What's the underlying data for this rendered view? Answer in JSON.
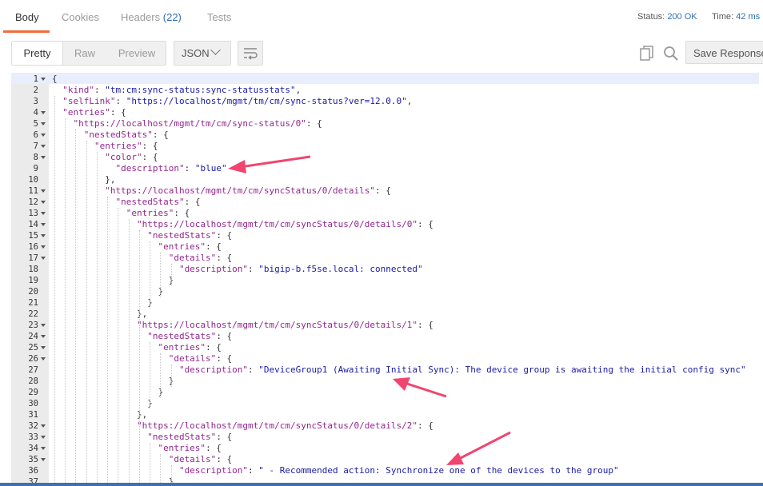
{
  "tabs": [
    {
      "label": "Body",
      "count": ""
    },
    {
      "label": "Cookies",
      "count": ""
    },
    {
      "label": "Headers",
      "count": "(22)"
    },
    {
      "label": "Tests",
      "count": ""
    }
  ],
  "status": {
    "status_label": "Status:",
    "status_value": "200 OK",
    "time_label": "Time:",
    "time_value": "42 ms"
  },
  "toolbar": {
    "view_modes": [
      "Pretty",
      "Raw",
      "Preview"
    ],
    "format": "JSON",
    "save_label": "Save Response"
  },
  "icons": {
    "wrap": "wrap-lines-icon",
    "copy": "copy-icon",
    "search": "search-icon",
    "chevron": "chevron-down-icon",
    "fold": "fold-arrow-icon"
  },
  "colors": {
    "accent": "#f26b3a",
    "link": "#2f6db5",
    "key": "#92278f",
    "string": "#1a1aa6",
    "arrow": "#f0456f"
  },
  "code_lines": [
    {
      "n": "1",
      "fold": true,
      "t": [
        {
          "c": "p",
          "v": "{"
        }
      ]
    },
    {
      "n": "2",
      "fold": false,
      "t": [
        {
          "c": "k",
          "v": "  \"kind\""
        },
        {
          "c": "p",
          "v": ": "
        },
        {
          "c": "s",
          "v": "\"tm:cm:sync-status:sync-statusstats\""
        },
        {
          "c": "p",
          "v": ","
        }
      ]
    },
    {
      "n": "3",
      "fold": false,
      "t": [
        {
          "c": "k",
          "v": "  \"selfLink\""
        },
        {
          "c": "p",
          "v": ": "
        },
        {
          "c": "s",
          "v": "\"https://localhost/mgmt/tm/cm/sync-status?ver=12.0.0\""
        },
        {
          "c": "p",
          "v": ","
        }
      ]
    },
    {
      "n": "4",
      "fold": true,
      "t": [
        {
          "c": "k",
          "v": "  \"entries\""
        },
        {
          "c": "p",
          "v": ": {"
        }
      ]
    },
    {
      "n": "5",
      "fold": true,
      "t": [
        {
          "c": "k",
          "v": "    \"https://localhost/mgmt/tm/cm/sync-status/0\""
        },
        {
          "c": "p",
          "v": ": {"
        }
      ]
    },
    {
      "n": "6",
      "fold": true,
      "t": [
        {
          "c": "k",
          "v": "      \"nestedStats\""
        },
        {
          "c": "p",
          "v": ": {"
        }
      ]
    },
    {
      "n": "7",
      "fold": true,
      "t": [
        {
          "c": "k",
          "v": "        \"entries\""
        },
        {
          "c": "p",
          "v": ": {"
        }
      ]
    },
    {
      "n": "8",
      "fold": true,
      "t": [
        {
          "c": "k",
          "v": "          \"color\""
        },
        {
          "c": "p",
          "v": ": {"
        }
      ]
    },
    {
      "n": "9",
      "fold": false,
      "t": [
        {
          "c": "k",
          "v": "            \"description\""
        },
        {
          "c": "p",
          "v": ": "
        },
        {
          "c": "s",
          "v": "\"blue\""
        }
      ]
    },
    {
      "n": "10",
      "fold": false,
      "t": [
        {
          "c": "p",
          "v": "          },"
        }
      ]
    },
    {
      "n": "11",
      "fold": true,
      "t": [
        {
          "c": "k",
          "v": "          \"https://localhost/mgmt/tm/cm/syncStatus/0/details\""
        },
        {
          "c": "p",
          "v": ": {"
        }
      ]
    },
    {
      "n": "12",
      "fold": true,
      "t": [
        {
          "c": "k",
          "v": "            \"nestedStats\""
        },
        {
          "c": "p",
          "v": ": {"
        }
      ]
    },
    {
      "n": "13",
      "fold": true,
      "t": [
        {
          "c": "k",
          "v": "              \"entries\""
        },
        {
          "c": "p",
          "v": ": {"
        }
      ]
    },
    {
      "n": "14",
      "fold": true,
      "t": [
        {
          "c": "k",
          "v": "                \"https://localhost/mgmt/tm/cm/syncStatus/0/details/0\""
        },
        {
          "c": "p",
          "v": ": {"
        }
      ]
    },
    {
      "n": "15",
      "fold": true,
      "t": [
        {
          "c": "k",
          "v": "                  \"nestedStats\""
        },
        {
          "c": "p",
          "v": ": {"
        }
      ]
    },
    {
      "n": "16",
      "fold": true,
      "t": [
        {
          "c": "k",
          "v": "                    \"entries\""
        },
        {
          "c": "p",
          "v": ": {"
        }
      ]
    },
    {
      "n": "17",
      "fold": true,
      "t": [
        {
          "c": "k",
          "v": "                      \"details\""
        },
        {
          "c": "p",
          "v": ": {"
        }
      ]
    },
    {
      "n": "18",
      "fold": false,
      "t": [
        {
          "c": "k",
          "v": "                        \"description\""
        },
        {
          "c": "p",
          "v": ": "
        },
        {
          "c": "s",
          "v": "\"bigip-b.f5se.local: connected\""
        }
      ]
    },
    {
      "n": "19",
      "fold": false,
      "t": [
        {
          "c": "p",
          "v": "                      }"
        }
      ]
    },
    {
      "n": "20",
      "fold": false,
      "t": [
        {
          "c": "p",
          "v": "                    }"
        }
      ]
    },
    {
      "n": "21",
      "fold": false,
      "t": [
        {
          "c": "p",
          "v": "                  }"
        }
      ]
    },
    {
      "n": "22",
      "fold": false,
      "t": [
        {
          "c": "p",
          "v": "                },"
        }
      ]
    },
    {
      "n": "23",
      "fold": true,
      "t": [
        {
          "c": "k",
          "v": "                \"https://localhost/mgmt/tm/cm/syncStatus/0/details/1\""
        },
        {
          "c": "p",
          "v": ": {"
        }
      ]
    },
    {
      "n": "24",
      "fold": true,
      "t": [
        {
          "c": "k",
          "v": "                  \"nestedStats\""
        },
        {
          "c": "p",
          "v": ": {"
        }
      ]
    },
    {
      "n": "25",
      "fold": true,
      "t": [
        {
          "c": "k",
          "v": "                    \"entries\""
        },
        {
          "c": "p",
          "v": ": {"
        }
      ]
    },
    {
      "n": "26",
      "fold": true,
      "t": [
        {
          "c": "k",
          "v": "                      \"details\""
        },
        {
          "c": "p",
          "v": ": {"
        }
      ]
    },
    {
      "n": "27",
      "fold": false,
      "t": [
        {
          "c": "k",
          "v": "                        \"description\""
        },
        {
          "c": "p",
          "v": ": "
        },
        {
          "c": "s",
          "v": "\"DeviceGroup1 (Awaiting Initial Sync): The device group is awaiting the initial config sync\""
        }
      ]
    },
    {
      "n": "28",
      "fold": false,
      "t": [
        {
          "c": "p",
          "v": "                      }"
        }
      ]
    },
    {
      "n": "29",
      "fold": false,
      "t": [
        {
          "c": "p",
          "v": "                    }"
        }
      ]
    },
    {
      "n": "30",
      "fold": false,
      "t": [
        {
          "c": "p",
          "v": "                  }"
        }
      ]
    },
    {
      "n": "31",
      "fold": false,
      "t": [
        {
          "c": "p",
          "v": "                },"
        }
      ]
    },
    {
      "n": "32",
      "fold": true,
      "t": [
        {
          "c": "k",
          "v": "                \"https://localhost/mgmt/tm/cm/syncStatus/0/details/2\""
        },
        {
          "c": "p",
          "v": ": {"
        }
      ]
    },
    {
      "n": "33",
      "fold": true,
      "t": [
        {
          "c": "k",
          "v": "                  \"nestedStats\""
        },
        {
          "c": "p",
          "v": ": {"
        }
      ]
    },
    {
      "n": "34",
      "fold": true,
      "t": [
        {
          "c": "k",
          "v": "                    \"entries\""
        },
        {
          "c": "p",
          "v": ": {"
        }
      ]
    },
    {
      "n": "35",
      "fold": true,
      "t": [
        {
          "c": "k",
          "v": "                      \"details\""
        },
        {
          "c": "p",
          "v": ": {"
        }
      ]
    },
    {
      "n": "36",
      "fold": false,
      "t": [
        {
          "c": "k",
          "v": "                        \"description\""
        },
        {
          "c": "p",
          "v": ": "
        },
        {
          "c": "s",
          "v": "\" - Recommended action: Synchronize one of the devices to the group\""
        }
      ]
    },
    {
      "n": "37",
      "fold": false,
      "t": [
        {
          "c": "p",
          "v": "                      }"
        }
      ]
    }
  ]
}
